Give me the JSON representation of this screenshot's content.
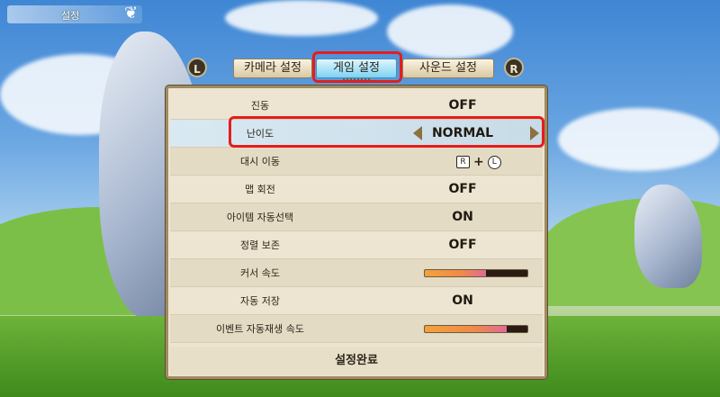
{
  "header": {
    "title": "설정"
  },
  "tabs": {
    "left_shoulder": "L",
    "right_shoulder": "R",
    "items": [
      {
        "label": "카메라 설정"
      },
      {
        "label": "게임 설정",
        "active": true
      },
      {
        "label": "사운드 설정"
      }
    ]
  },
  "settings": {
    "rows": [
      {
        "label": "진동",
        "value": "OFF"
      },
      {
        "label": "난이도",
        "value": "NORMAL",
        "selected": true
      },
      {
        "label": "대시 이동",
        "key_a": "R",
        "key_plus": "+",
        "key_b": "L"
      },
      {
        "label": "맵 회전",
        "value": "OFF"
      },
      {
        "label": "아이템 자동선택",
        "value": "ON"
      },
      {
        "label": "정렬 보존",
        "value": "OFF"
      },
      {
        "label": "커서 속도",
        "slider_fraction": 0.6
      },
      {
        "label": "자동 저장",
        "value": "ON"
      },
      {
        "label": "이벤트 자동재생 속도",
        "slider_fraction": 0.8
      }
    ],
    "complete_label": "설정완료"
  },
  "colors": {
    "highlight": "#e41d1d",
    "active_tab": "#7fd2f2",
    "panel": "#ede5d2"
  }
}
